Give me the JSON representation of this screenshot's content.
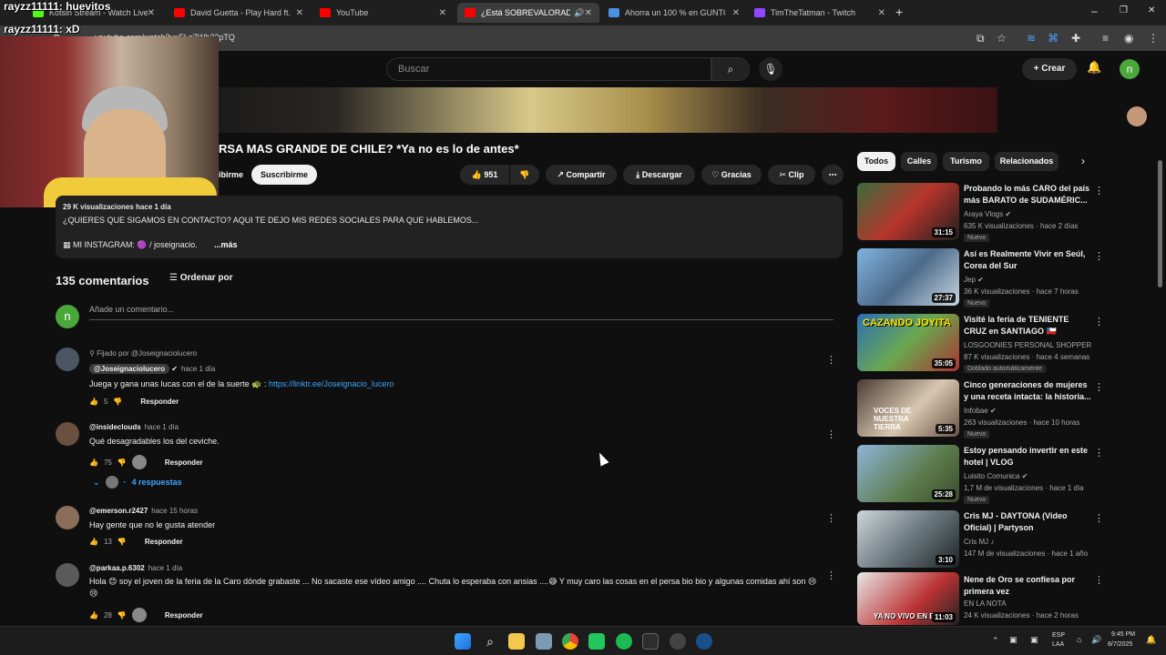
{
  "browser": {
    "tabs": [
      {
        "label": "Kotsin Stream - Watch Live on",
        "icon": "kick-favicon",
        "color": "#53fc18"
      },
      {
        "label": "David Guetta - Play Hard ft. Ne",
        "icon": "youtube-favicon",
        "color": "#ff0000"
      },
      {
        "label": "YouTube",
        "icon": "youtube-favicon",
        "color": "#ff0000"
      },
      {
        "label": "¿Está SOBREVALORADO el",
        "icon": "youtube-favicon",
        "color": "#ff0000"
      },
      {
        "label": "Ahorra un 100 % en GUNTOUC",
        "icon": "steam-favicon",
        "color": "#4a90e2"
      },
      {
        "label": "TimTheTatman - Twitch",
        "icon": "twitch-favicon",
        "color": "#9146ff"
      }
    ],
    "url": "youtube.com/watch?v=FLq7Wb33pTQ"
  },
  "overlay": {
    "name_top": "rayzz11111: huevitos",
    "name_bottom": "rayzz11111: xD"
  },
  "youtube": {
    "search_placeholder": "Buscar",
    "create_label": "Crear",
    "avatar_letter": "n"
  },
  "video": {
    "title": "RSA MAS GRANDE DE CHILE? *Ya no es lo de antes*",
    "subscribe_partial": "ibirme",
    "subscribe_label": "Suscribirme",
    "likes": "951",
    "share_label": "Compartir",
    "download_label": "Descargar",
    "thanks_label": "Gracias",
    "clip_label": "Clip"
  },
  "description": {
    "line1": "29 K visualizaciones  hace 1 día",
    "line2": "¿QUIERES QUE SIGAMOS EN CONTACTO? AQUI TE DEJO MIS REDES SOCIALES PARA QUE HABLEMOS...",
    "line3": "MI INSTAGRAM: 🟣 / joseignacio.",
    "more": "...más"
  },
  "comments": {
    "count_label": "135 comentarios",
    "sort_label": "Ordenar por",
    "add_placeholder": "Añade un comentario...",
    "reply_label": "Responder",
    "items": [
      {
        "pinned": "Fijado por @Joseignaciolucero",
        "author": "@Joseignaciolucero",
        "time": "hace 1 día",
        "text": "Juega y gana unas lucas con el de la suerte 🐢 :",
        "link": "https://linktr.ee/Joseignacio_lucero",
        "likes": "5"
      },
      {
        "author": "@insideclouds",
        "time": "hace 1 día",
        "text": "Qué desagradables los del ceviche.",
        "likes": "75",
        "replies": "4 respuestas"
      },
      {
        "author": "@emerson.r2427",
        "time": "hace 15 horas",
        "text": "Hay gente que no le gusta atender",
        "likes": "13"
      },
      {
        "author": "@parkaa.p.6302",
        "time": "hace 1 día",
        "text": "Hola 😊 soy el joven de la feria de la Caro dónde grabaste ... No sacaste ese vídeo amigo .... Chuta lo esperaba con ansias ....😅 Y muy caro las cosas en el persa bio bio y algunas comidas ahí son 😢😢",
        "likes": "28"
      }
    ]
  },
  "sidebar": {
    "chips": [
      "Todos",
      "Calles",
      "Turismo",
      "Relacionados"
    ],
    "videos": [
      {
        "title": "Probando lo más CARO del país más BARATO de SUDAMÉRIC...",
        "channel": "Araya Vlogs",
        "meta": "635 K visualizaciones · hace 2 días",
        "badge": "Nuevo",
        "duration": "31:15"
      },
      {
        "title": "Así es Realmente Vivir en Seúl, Corea del Sur",
        "channel": "Jep",
        "meta": "36 K visualizaciones · hace 7 horas",
        "badge": "Nuevo",
        "duration": "27:37"
      },
      {
        "title": "Visité la feria de TENIENTE CRUZ en SANTIAGO 🇨🇱",
        "channel": "LOSGOONIES PERSONAL SHOPPER",
        "meta": "87 K visualizaciones · hace 4 semanas",
        "badge": "Doblado automáticamente",
        "duration": "35:05",
        "thumb_text": "CAZANDO JOYITA"
      },
      {
        "title": "Cinco generaciones de mujeres y una receta intacta: la historia...",
        "channel": "Infobae",
        "meta": "263 visualizaciones · hace 10 horas",
        "badge": "Nuevo",
        "duration": "5:35",
        "thumb_text": "VOCES DE NUESTRA TIERRA"
      },
      {
        "title": "Estoy pensando invertir en este hotel | VLOG",
        "channel": "Luisito Comunica",
        "meta": "1,7 M de visualizaciones · hace 1 día",
        "badge": "Nuevo",
        "duration": "25:28"
      },
      {
        "title": "Cris MJ - DAYTONA (Video Oficial) | Partyson",
        "channel": "Cris MJ",
        "meta": "147 M de visualizaciones · hace 1 año",
        "badge": "",
        "duration": "3:10"
      },
      {
        "title": "Nene de Oro se confiesa por primera vez",
        "channel": "EN LA NOTA",
        "meta": "24 K visualizaciones · hace 2 horas",
        "badge": "",
        "duration": "11:03",
        "thumb_text": "YA NO VIVO EN EL"
      }
    ]
  },
  "taskbar": {
    "lang_top": "ESP",
    "lang_bottom": "LAA",
    "time": "9:45 PM",
    "date": "8/7/2025"
  }
}
